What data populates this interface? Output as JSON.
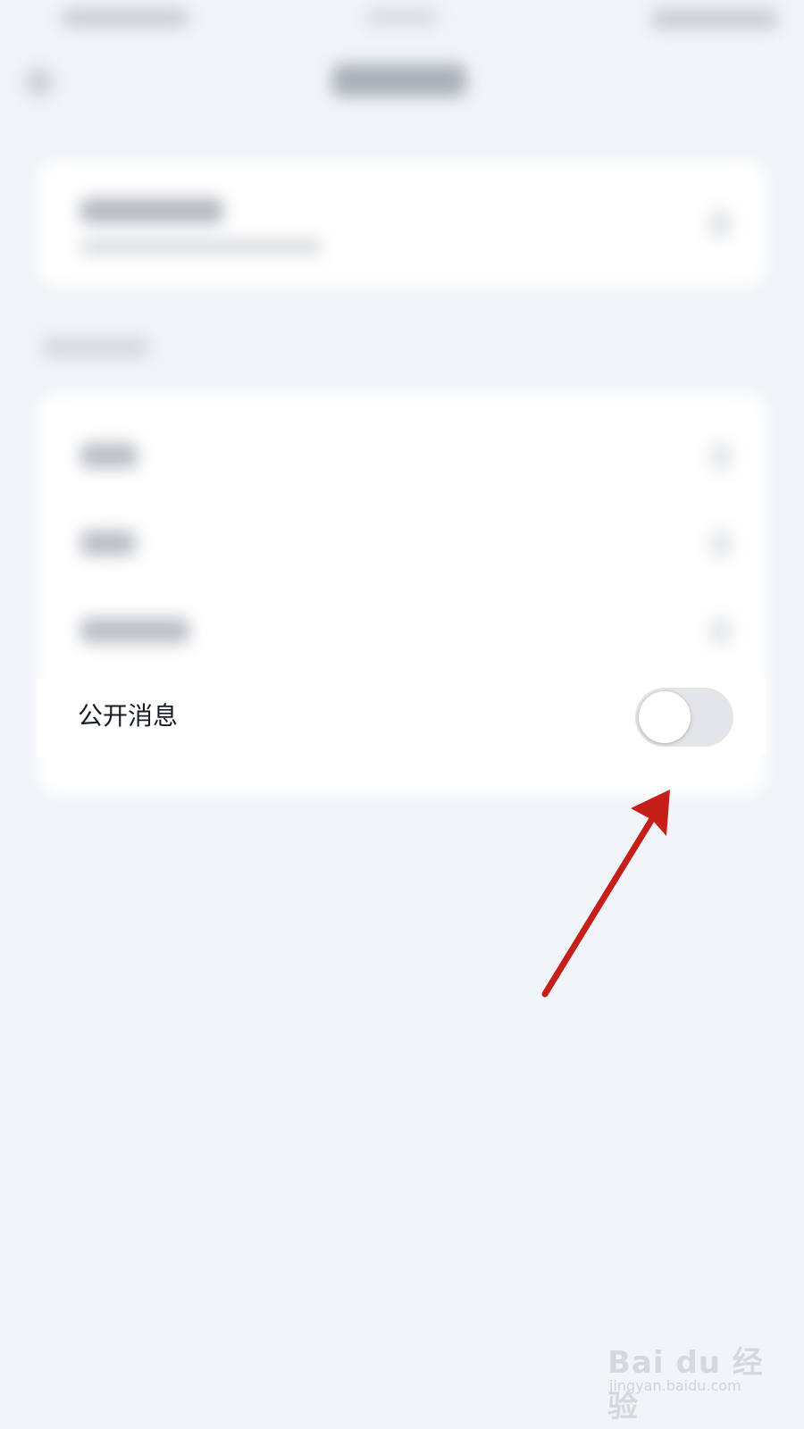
{
  "public_message": {
    "label": "公开消息",
    "toggle_state": "off"
  },
  "watermark": {
    "logo": "Bai du 经验",
    "url": "jingyan.baidu.com"
  },
  "colors": {
    "background": "#f1f4f8",
    "card": "#ffffff",
    "toggle_off_track": "#e4e5e9",
    "annotation_arrow": "#c61f1a",
    "label_text": "#161c26"
  },
  "icons": {
    "back": "back-chevron-icon",
    "row_chevron": "chevron-right-icon",
    "annotation": "red-arrow-annotation"
  }
}
